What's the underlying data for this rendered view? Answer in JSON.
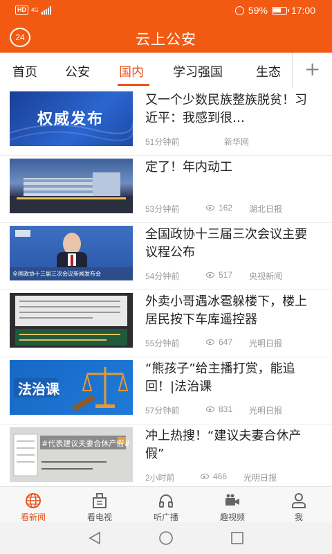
{
  "status_bar": {
    "network": "4G",
    "hd": "HD",
    "battery": "59%",
    "time": "17:00"
  },
  "header": {
    "logo": "24",
    "title": "云上公安"
  },
  "tabs": [
    {
      "label": "首页"
    },
    {
      "label": "公安"
    },
    {
      "label": "国内"
    },
    {
      "label": "学习强国"
    },
    {
      "label": "生态"
    }
  ],
  "active_tab": "国内",
  "news": [
    {
      "title": "又一个少数民族整族脱贫！习近平：我感到很…",
      "time": "51分钟前",
      "views": "",
      "source": "新华网",
      "thumb_text": "权威发布"
    },
    {
      "title": "定了！年内动工",
      "time": "53分钟前",
      "views": "162",
      "source": "湖北日报"
    },
    {
      "title": "全国政协十三届三次会议主要议程公布",
      "time": "54分钟前",
      "views": "517",
      "source": "央视新闻",
      "thumb_caption": "全国政协十三届三次会议新闻发布会"
    },
    {
      "title": "外卖小哥遇冰雹躲楼下，楼上居民按下车库遥控器",
      "time": "55分钟前",
      "views": "647",
      "source": "光明日报"
    },
    {
      "title": "“熊孩子”给主播打赏，能追回！|法治课",
      "time": "57分钟前",
      "views": "831",
      "source": "光明日报",
      "thumb_text": "法治课"
    },
    {
      "title": "冲上热搜！“建议夫妻合休产假”",
      "time": "2小时前",
      "views": "466",
      "source": "光明日报",
      "thumb_text": "#代表建议夫妻合休产假#"
    }
  ],
  "bottom_nav": [
    {
      "label": "看新闻",
      "icon": "globe-icon"
    },
    {
      "label": "看电视",
      "icon": "building-icon"
    },
    {
      "label": "听广播",
      "icon": "headphones-icon"
    },
    {
      "label": "趣视频",
      "icon": "video-camera-icon"
    },
    {
      "label": "我",
      "icon": "user-icon"
    }
  ],
  "colors": {
    "brand": "#f25a14",
    "active": "#e8501a"
  }
}
